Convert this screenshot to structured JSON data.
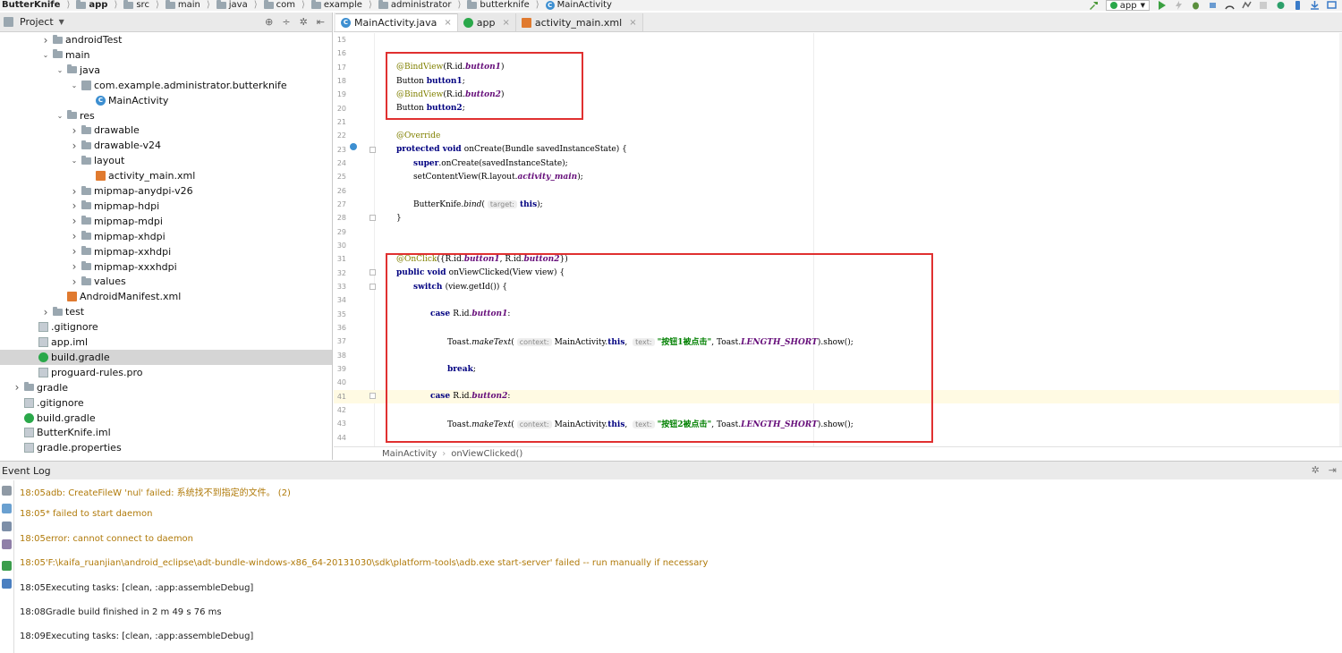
{
  "breadcrumb": [
    "ButterKnife",
    "app",
    "src",
    "main",
    "java",
    "com",
    "example",
    "administrator",
    "butterknife",
    "MainActivity"
  ],
  "toolbar": {
    "run_config": "app"
  },
  "project_panel": {
    "title": "Project",
    "items": [
      {
        "label": "androidTest",
        "indent": 3,
        "arrow": "right",
        "icon": "folder"
      },
      {
        "label": "main",
        "indent": 3,
        "arrow": "down",
        "icon": "folder"
      },
      {
        "label": "java",
        "indent": 4,
        "arrow": "down",
        "icon": "folder"
      },
      {
        "label": "com.example.administrator.butterknife",
        "indent": 5,
        "arrow": "down",
        "icon": "package"
      },
      {
        "label": "MainActivity",
        "indent": 6,
        "arrow": "",
        "icon": "java"
      },
      {
        "label": "res",
        "indent": 4,
        "arrow": "down",
        "icon": "folder"
      },
      {
        "label": "drawable",
        "indent": 5,
        "arrow": "right",
        "icon": "folder"
      },
      {
        "label": "drawable-v24",
        "indent": 5,
        "arrow": "right",
        "icon": "folder"
      },
      {
        "label": "layout",
        "indent": 5,
        "arrow": "down",
        "icon": "folder"
      },
      {
        "label": "activity_main.xml",
        "indent": 6,
        "arrow": "",
        "icon": "xml"
      },
      {
        "label": "mipmap-anydpi-v26",
        "indent": 5,
        "arrow": "right",
        "icon": "folder"
      },
      {
        "label": "mipmap-hdpi",
        "indent": 5,
        "arrow": "right",
        "icon": "folder"
      },
      {
        "label": "mipmap-mdpi",
        "indent": 5,
        "arrow": "right",
        "icon": "folder"
      },
      {
        "label": "mipmap-xhdpi",
        "indent": 5,
        "arrow": "right",
        "icon": "folder"
      },
      {
        "label": "mipmap-xxhdpi",
        "indent": 5,
        "arrow": "right",
        "icon": "folder"
      },
      {
        "label": "mipmap-xxxhdpi",
        "indent": 5,
        "arrow": "right",
        "icon": "folder"
      },
      {
        "label": "values",
        "indent": 5,
        "arrow": "right",
        "icon": "folder"
      },
      {
        "label": "AndroidManifest.xml",
        "indent": 4,
        "arrow": "",
        "icon": "xml"
      },
      {
        "label": "test",
        "indent": 3,
        "arrow": "right",
        "icon": "folder"
      },
      {
        "label": ".gitignore",
        "indent": 2,
        "arrow": "",
        "icon": "file"
      },
      {
        "label": "app.iml",
        "indent": 2,
        "arrow": "",
        "icon": "file"
      },
      {
        "label": "build.gradle",
        "indent": 2,
        "arrow": "",
        "icon": "gradle",
        "selected": true
      },
      {
        "label": "proguard-rules.pro",
        "indent": 2,
        "arrow": "",
        "icon": "file"
      },
      {
        "label": "gradle",
        "indent": 1,
        "arrow": "right",
        "icon": "folder"
      },
      {
        "label": ".gitignore",
        "indent": 1,
        "arrow": "",
        "icon": "file"
      },
      {
        "label": "build.gradle",
        "indent": 1,
        "arrow": "",
        "icon": "gradle"
      },
      {
        "label": "ButterKnife.iml",
        "indent": 1,
        "arrow": "",
        "icon": "file"
      },
      {
        "label": "gradle.properties",
        "indent": 1,
        "arrow": "",
        "icon": "file"
      }
    ]
  },
  "editor": {
    "tabs": [
      {
        "label": "MainActivity.java",
        "icon": "java",
        "active": true
      },
      {
        "label": "app",
        "icon": "gradle",
        "active": false
      },
      {
        "label": "activity_main.xml",
        "icon": "xml",
        "active": false
      }
    ],
    "lines": [
      {
        "n": "15",
        "indent": 0,
        "parts": []
      },
      {
        "n": "16",
        "indent": 0,
        "parts": []
      },
      {
        "n": "17",
        "indent": 1,
        "parts": [
          {
            "t": "@BindView",
            "c": "ann"
          },
          {
            "t": "(R.id."
          },
          {
            "t": "button1",
            "c": "field"
          },
          {
            "t": ")"
          }
        ]
      },
      {
        "n": "18",
        "indent": 1,
        "parts": [
          {
            "t": "Button "
          },
          {
            "t": "button1",
            "c": "kwb"
          },
          {
            "t": ";"
          }
        ]
      },
      {
        "n": "19",
        "indent": 1,
        "parts": [
          {
            "t": "@BindView",
            "c": "ann"
          },
          {
            "t": "(R.id."
          },
          {
            "t": "button2",
            "c": "field"
          },
          {
            "t": ")"
          }
        ]
      },
      {
        "n": "20",
        "indent": 1,
        "parts": [
          {
            "t": "Button "
          },
          {
            "t": "button2",
            "c": "kwb"
          },
          {
            "t": ";"
          }
        ]
      },
      {
        "n": "21",
        "indent": 0,
        "parts": []
      },
      {
        "n": "22",
        "indent": 1,
        "parts": [
          {
            "t": "@Override",
            "c": "ann"
          }
        ]
      },
      {
        "n": "23",
        "indent": 1,
        "parts": [
          {
            "t": "protected ",
            "c": "kw"
          },
          {
            "t": "void ",
            "c": "kw"
          },
          {
            "t": "onCreate(Bundle savedInstanceState) {"
          }
        ]
      },
      {
        "n": "24",
        "indent": 2,
        "parts": [
          {
            "t": "super",
            "c": "kw"
          },
          {
            "t": ".onCreate(savedInstanceState);"
          }
        ]
      },
      {
        "n": "25",
        "indent": 2,
        "parts": [
          {
            "t": "setContentView(R.layout."
          },
          {
            "t": "activity_main",
            "c": "field"
          },
          {
            "t": ");"
          }
        ]
      },
      {
        "n": "26",
        "indent": 0,
        "parts": []
      },
      {
        "n": "27",
        "indent": 2,
        "parts": [
          {
            "t": "ButterKnife."
          },
          {
            "t": "bind",
            "c": "it"
          },
          {
            "t": "("
          },
          {
            "t": "target:",
            "c": "hint"
          },
          {
            "t": "this",
            "c": "kw"
          },
          {
            "t": ");"
          }
        ]
      },
      {
        "n": "28",
        "indent": 1,
        "parts": [
          {
            "t": "}"
          }
        ]
      },
      {
        "n": "29",
        "indent": 0,
        "parts": []
      },
      {
        "n": "30",
        "indent": 0,
        "parts": []
      },
      {
        "n": "31",
        "indent": 1,
        "parts": [
          {
            "t": "@OnClick",
            "c": "ann"
          },
          {
            "t": "({R.id."
          },
          {
            "t": "button1",
            "c": "field"
          },
          {
            "t": ", R.id."
          },
          {
            "t": "button2",
            "c": "field"
          },
          {
            "t": "})"
          }
        ]
      },
      {
        "n": "32",
        "indent": 1,
        "parts": [
          {
            "t": "public ",
            "c": "kw"
          },
          {
            "t": "void ",
            "c": "kw"
          },
          {
            "t": "onViewClicked(View view) {"
          }
        ]
      },
      {
        "n": "33",
        "indent": 2,
        "parts": [
          {
            "t": "switch ",
            "c": "kw"
          },
          {
            "t": "(view.getId()) {"
          }
        ]
      },
      {
        "n": "34",
        "indent": 0,
        "parts": []
      },
      {
        "n": "35",
        "indent": 3,
        "parts": [
          {
            "t": "case ",
            "c": "kw"
          },
          {
            "t": "R.id."
          },
          {
            "t": "button1",
            "c": "field"
          },
          {
            "t": ":"
          }
        ]
      },
      {
        "n": "36",
        "indent": 0,
        "parts": []
      },
      {
        "n": "37",
        "indent": 4,
        "parts": [
          {
            "t": "Toast."
          },
          {
            "t": "makeText",
            "c": "it"
          },
          {
            "t": "("
          },
          {
            "t": "context:",
            "c": "hint"
          },
          {
            "t": "MainActivity."
          },
          {
            "t": "this",
            "c": "kw"
          },
          {
            "t": ", "
          },
          {
            "t": "text:",
            "c": "hint"
          },
          {
            "t": "\"按钮1被点击\"",
            "c": "str"
          },
          {
            "t": ", Toast."
          },
          {
            "t": "LENGTH_SHORT",
            "c": "field"
          },
          {
            "t": ").show();"
          }
        ]
      },
      {
        "n": "38",
        "indent": 0,
        "parts": []
      },
      {
        "n": "39",
        "indent": 4,
        "parts": [
          {
            "t": "break",
            "c": "kw"
          },
          {
            "t": ";"
          }
        ]
      },
      {
        "n": "40",
        "indent": 0,
        "parts": []
      },
      {
        "n": "41",
        "indent": 3,
        "hl": true,
        "parts": [
          {
            "t": "case ",
            "c": "kw"
          },
          {
            "t": "R.id."
          },
          {
            "t": "button2",
            "c": "field"
          },
          {
            "t": ":"
          }
        ]
      },
      {
        "n": "42",
        "indent": 0,
        "parts": []
      },
      {
        "n": "43",
        "indent": 4,
        "parts": [
          {
            "t": "Toast."
          },
          {
            "t": "makeText",
            "c": "it"
          },
          {
            "t": "("
          },
          {
            "t": "context:",
            "c": "hint"
          },
          {
            "t": "MainActivity."
          },
          {
            "t": "this",
            "c": "kw"
          },
          {
            "t": ", "
          },
          {
            "t": "text:",
            "c": "hint"
          },
          {
            "t": "\"按钮2被点击\"",
            "c": "str"
          },
          {
            "t": ", Toast."
          },
          {
            "t": "LENGTH_SHORT",
            "c": "field"
          },
          {
            "t": ").show();"
          }
        ]
      },
      {
        "n": "44",
        "indent": 0,
        "parts": []
      }
    ],
    "breadcrumb": [
      "MainActivity",
      "onViewClicked()"
    ]
  },
  "event_log": {
    "title": "Event Log",
    "entries": [
      {
        "time": "18:05",
        "text": "adb: CreateFileW 'nul' failed: 系统找不到指定的文件。 (2)",
        "level": "warn"
      },
      {
        "time": "18:05",
        "text": "* failed to start daemon",
        "level": "warn"
      },
      {
        "time": "18:05",
        "text": "error: cannot connect to daemon",
        "level": "warn"
      },
      {
        "time": "18:05",
        "text": "'F:\\kaifa_ruanjian\\android_eclipse\\adt-bundle-windows-x86_64-20131030\\sdk\\platform-tools\\adb.exe start-server' failed -- run manually if necessary",
        "level": "warn"
      },
      {
        "time": "18:05",
        "text": "Executing tasks: [clean, :app:assembleDebug]",
        "level": "info"
      },
      {
        "time": "18:08",
        "text": "Gradle build finished in 2 m 49 s 76 ms",
        "level": "info"
      },
      {
        "time": "18:09",
        "text": "Executing tasks: [clean, :app:assembleDebug]",
        "level": "info"
      }
    ]
  },
  "colors": {
    "highlight_box": "#e03030",
    "warn_text": "#b07a0a",
    "selection": "#d5d5d5",
    "current_line": "#fffae3"
  }
}
